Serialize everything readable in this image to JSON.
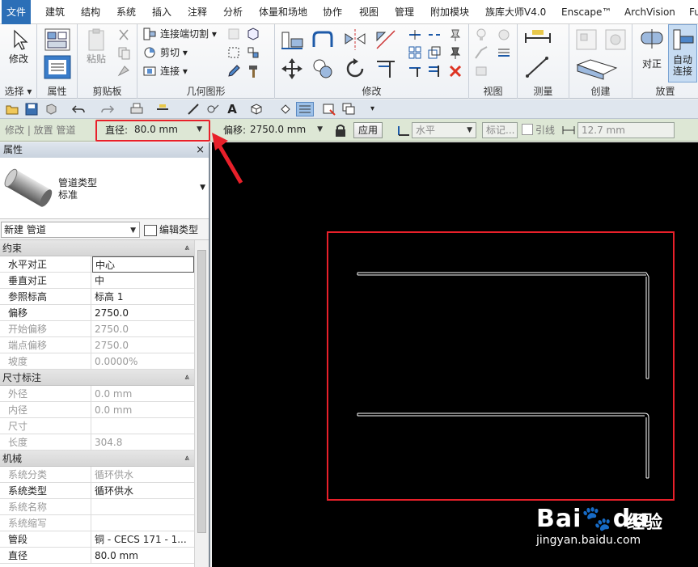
{
  "menu": {
    "items": [
      "文件",
      "建筑",
      "结构",
      "系统",
      "插入",
      "注释",
      "分析",
      "体量和场地",
      "协作",
      "视图",
      "管理",
      "附加模块",
      "族库大师V4.0",
      "Enscape™",
      "ArchVision",
      "Fu"
    ]
  },
  "ribbon": {
    "select": {
      "modify_label": "修改",
      "panel_label": "选择 ▾"
    },
    "properties": {
      "panel_label": "属性"
    },
    "clipboard": {
      "paste_label": "粘贴",
      "panel_label": "剪贴板"
    },
    "geometry": {
      "join_cut_label": "连接端切割 ▾",
      "cut_label": "剪切 ▾",
      "connect_label": "连接 ▾",
      "panel_label": "几何图形"
    },
    "modify": {
      "panel_label": "修改"
    },
    "view": {
      "panel_label": "视图"
    },
    "measure": {
      "panel_label": "测量"
    },
    "create": {
      "panel_label": "创建"
    },
    "placement": {
      "align_label": "对正",
      "auto_connect_label": "自动\n连接",
      "panel_label": "放置"
    }
  },
  "options_bar": {
    "context": "修改 | 放置 管道",
    "diameter_label": "直径:",
    "diameter_value": "80.0 mm",
    "offset_label": "偏移:",
    "offset_value": "2750.0 mm",
    "apply_label": "应用",
    "horizontal_value": "水平",
    "tag_label": "标记...",
    "leader_label": "引线",
    "leader_length": "12.7 mm"
  },
  "properties": {
    "title": "属性",
    "close": "×",
    "type_name_line1": "管道类型",
    "type_name_line2": "标准",
    "instance_selector": "新建 管道",
    "edit_type": "编辑类型",
    "sections": [
      {
        "name": "约束",
        "rows": [
          {
            "key": "水平对正",
            "value": "中心",
            "disabled": false,
            "editing": true
          },
          {
            "key": "垂直对正",
            "value": "中",
            "disabled": false
          },
          {
            "key": "参照标高",
            "value": "标高 1",
            "disabled": false
          },
          {
            "key": "偏移",
            "value": "2750.0",
            "disabled": false
          },
          {
            "key": "开始偏移",
            "value": "2750.0",
            "disabled": true
          },
          {
            "key": "端点偏移",
            "value": "2750.0",
            "disabled": true
          },
          {
            "key": "坡度",
            "value": "0.0000%",
            "disabled": true
          }
        ]
      },
      {
        "name": "尺寸标注",
        "rows": [
          {
            "key": "外径",
            "value": "0.0 mm",
            "disabled": true
          },
          {
            "key": "内径",
            "value": "0.0 mm",
            "disabled": true
          },
          {
            "key": "尺寸",
            "value": "",
            "disabled": true
          },
          {
            "key": "长度",
            "value": "304.8",
            "disabled": true
          }
        ]
      },
      {
        "name": "机械",
        "rows": [
          {
            "key": "系统分类",
            "value": "循环供水",
            "disabled": true
          },
          {
            "key": "系统类型",
            "value": "循环供水",
            "disabled": false
          },
          {
            "key": "系统名称",
            "value": "",
            "disabled": true
          },
          {
            "key": "系统缩写",
            "value": "",
            "disabled": true
          },
          {
            "key": "管段",
            "value": "铜 - CECS 171 - 1...",
            "disabled": false
          },
          {
            "key": "直径",
            "value": "80.0 mm",
            "disabled": false
          }
        ]
      }
    ]
  },
  "watermark": {
    "brand": "Bai",
    "suffix": "du",
    "jingyan": "经验",
    "url": "jingyan.baidu.com"
  },
  "colors": {
    "highlight": "#e8202a",
    "menu_active": "#2c6fb7",
    "canvas": "#000000"
  }
}
